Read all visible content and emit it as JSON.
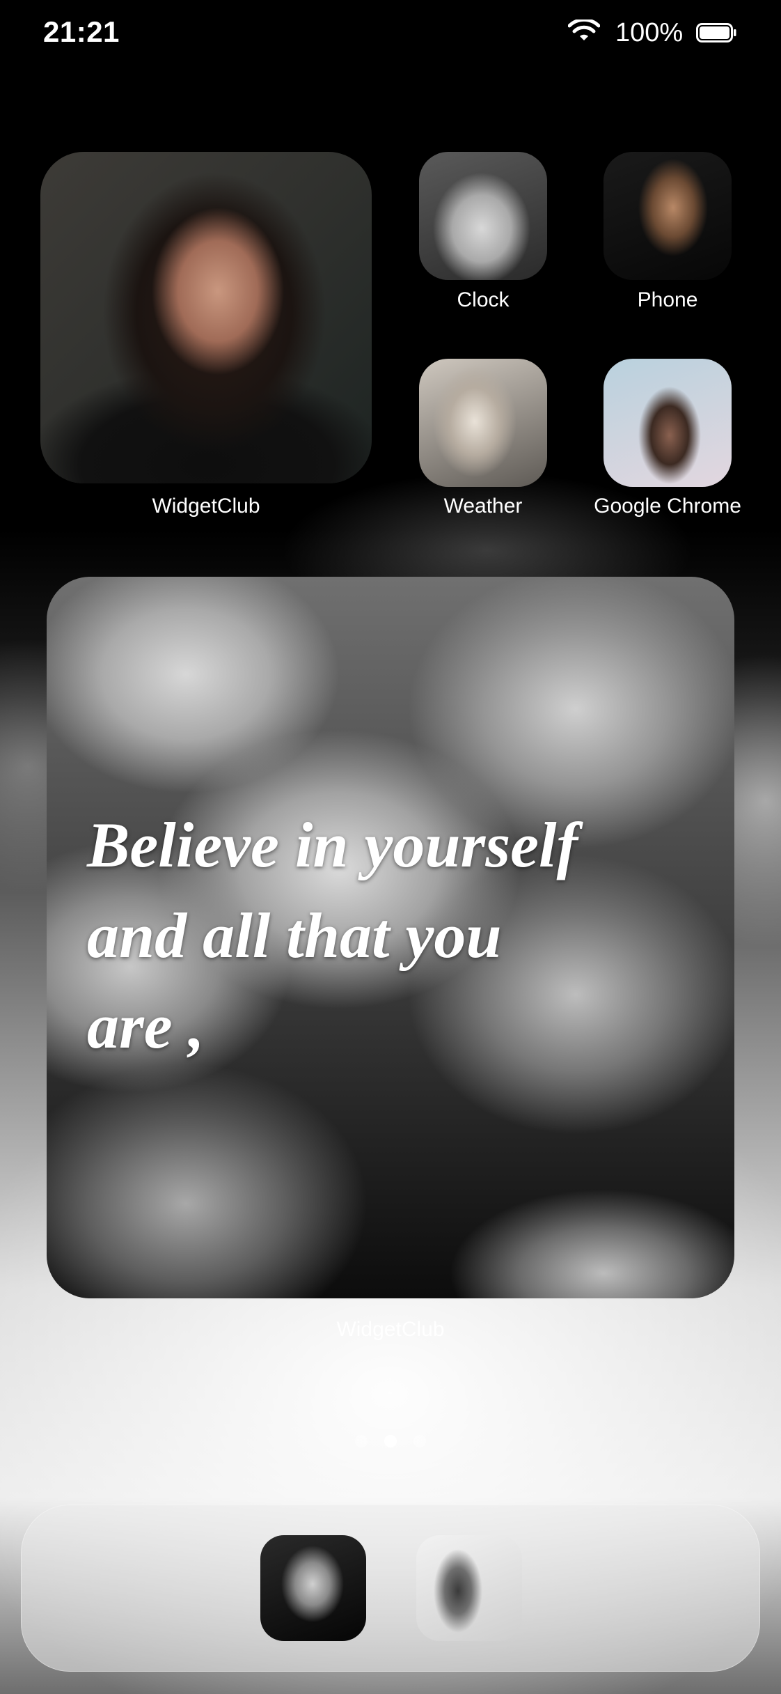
{
  "status_bar": {
    "time": "21:21",
    "battery_percent": "100%",
    "wifi_icon": "wifi-icon",
    "battery_icon": "battery-full-icon"
  },
  "widgets": {
    "photo_widget_label": "WidgetClub",
    "quote_widget": {
      "lines": [
        "Believe in yourself",
        "and all that you",
        "are ,"
      ],
      "label": "WidgetClub"
    }
  },
  "apps": [
    {
      "label": "Clock"
    },
    {
      "label": "Phone"
    },
    {
      "label": "Weather"
    },
    {
      "label": "Google Chrome"
    }
  ],
  "page_indicator": {
    "count": 3,
    "active_index": 1
  },
  "dock": {
    "apps": [
      "photo-app-icon",
      "photo-app-icon"
    ]
  },
  "colors": {
    "text": "#ffffff",
    "background_top": "#000000",
    "background_bottom": "#ececec"
  }
}
